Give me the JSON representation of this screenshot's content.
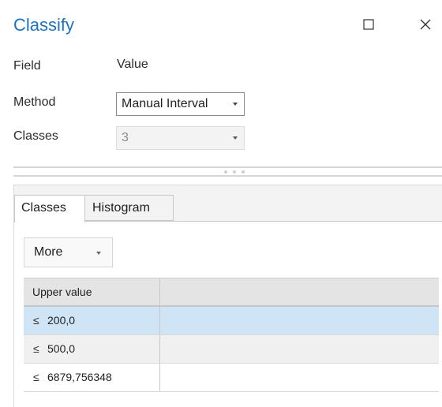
{
  "pane": {
    "title": "Classify"
  },
  "form": {
    "field_label": "Field",
    "field_value": "Value",
    "method_label": "Method",
    "method_value": "Manual Interval",
    "classes_label": "Classes",
    "classes_value": "3"
  },
  "tabs": [
    {
      "label": "Classes",
      "active": true
    },
    {
      "label": "Histogram",
      "active": false
    }
  ],
  "toolbar": {
    "more_label": "More"
  },
  "table": {
    "header": "Upper value",
    "rows": [
      {
        "op": "≤",
        "value": "200,0",
        "selected": true
      },
      {
        "op": "≤",
        "value": "500,0",
        "selected": false
      },
      {
        "op": "≤",
        "value": "6879,756348",
        "selected": false
      }
    ]
  },
  "icons": {
    "maximize": "maximize-icon",
    "close": "close-icon"
  },
  "colors": {
    "title": "#1e73be",
    "selected_row": "#cfe5f6"
  }
}
